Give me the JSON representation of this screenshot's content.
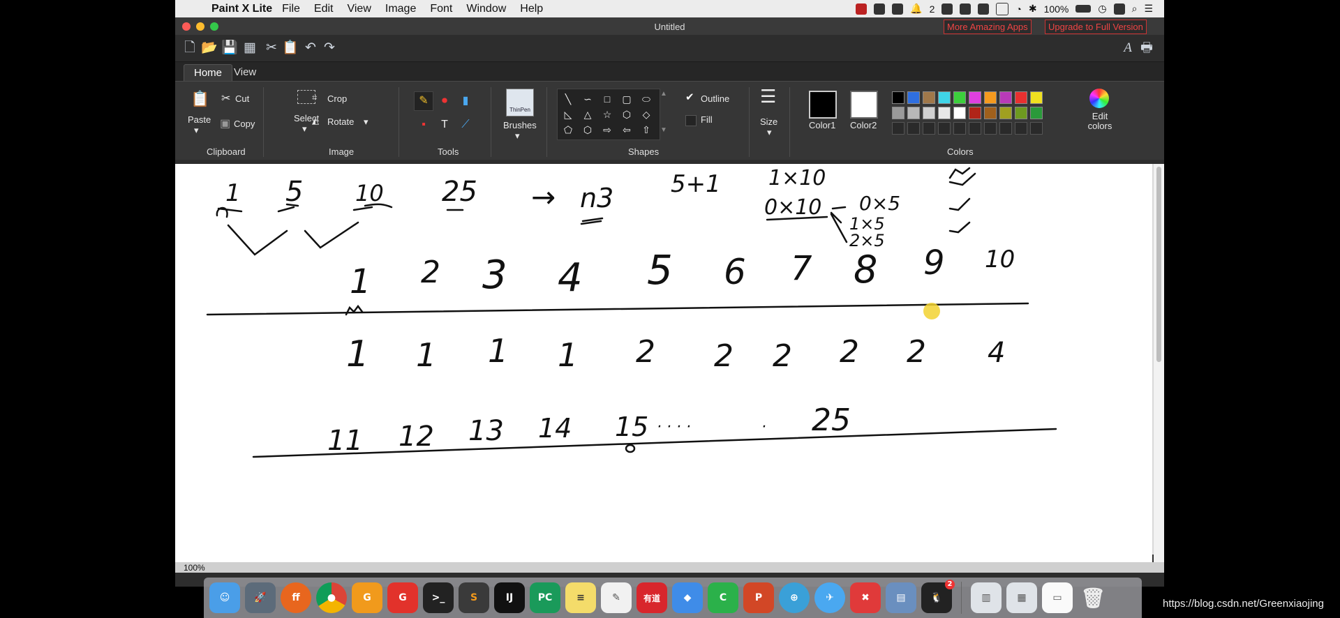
{
  "menubar": {
    "app_name": "Paint X Lite",
    "menus": [
      "File",
      "Edit",
      "View",
      "Image",
      "Font",
      "Window",
      "Help"
    ],
    "notification_count": "2",
    "battery": "100%"
  },
  "window": {
    "title": "Untitled",
    "promo_buttons": [
      "More Amazing Apps",
      "Upgrade to Full Version"
    ]
  },
  "tabs": [
    "Home",
    "View"
  ],
  "ribbon": {
    "clipboard": {
      "paste": "Paste",
      "cut": "Cut",
      "copy": "Copy",
      "group": "Clipboard"
    },
    "image": {
      "select": "Select",
      "crop": "Crop",
      "rotate": "Rotate",
      "group": "Image"
    },
    "tools": {
      "group": "Tools",
      "text_tool": "T"
    },
    "brushes": {
      "label": "Brushes",
      "preview": "ThinPen"
    },
    "shapes": {
      "outline": "Outline",
      "fill": "Fill",
      "group": "Shapes"
    },
    "size": {
      "label": "Size"
    },
    "colors": {
      "color1": "Color1",
      "color2": "Color2",
      "edit": "Edit colors",
      "group": "Colors",
      "color1_value": "#000000",
      "color2_value": "#ffffff",
      "palette_row1": [
        "#000000",
        "#2f6fe0",
        "#a0784a",
        "#3fd4e8",
        "#3ccf3c",
        "#e040e0",
        "#f59a1e",
        "#b83ab8",
        "#e83030",
        "#f0e020"
      ],
      "palette_row2": [
        "#9a9a9a",
        "#b8b8b8",
        "#d0d0d0",
        "#e8e8e8",
        "#ffffff",
        "#b02418",
        "#a0601c",
        "#a0a020",
        "#6e9a20",
        "#2a9a3a"
      ]
    }
  },
  "canvas": {
    "row1": [
      "1",
      "5",
      "10",
      "25",
      "→",
      "n3",
      "5+1",
      "1×10",
      "0×10",
      "0×5",
      "1×5",
      "2×5"
    ],
    "row2": [
      "1",
      "2",
      "3",
      "4",
      "5",
      "6",
      "7",
      "8",
      "9",
      "10"
    ],
    "row3": [
      "1",
      "1",
      "1",
      "1",
      "2",
      "2",
      "2",
      "2",
      "2",
      "4"
    ],
    "row4": [
      "11",
      "12",
      "13",
      "14",
      "15",
      "· · · ·",
      "·",
      "25"
    ]
  },
  "status": {
    "zoom": "100%"
  },
  "dock": [
    "Finder",
    "Launchpad",
    "Firefox",
    "Chrome",
    "PDF Expert",
    "Git Client",
    "Terminal",
    "Sublime Text",
    "IntelliJ IDEA",
    "PyCharm",
    "Notes",
    "TextEdit",
    "有道",
    "Eraser",
    "Cloud",
    "PowerPoint",
    "Network",
    "Paper Plane",
    "XMind",
    "Preview",
    "QQ",
    "Documents",
    "Finder Window",
    "Paint X",
    "Trash"
  ],
  "dock_qq_badge": "2",
  "watermark": "https://blog.csdn.net/Greenxiaojing"
}
